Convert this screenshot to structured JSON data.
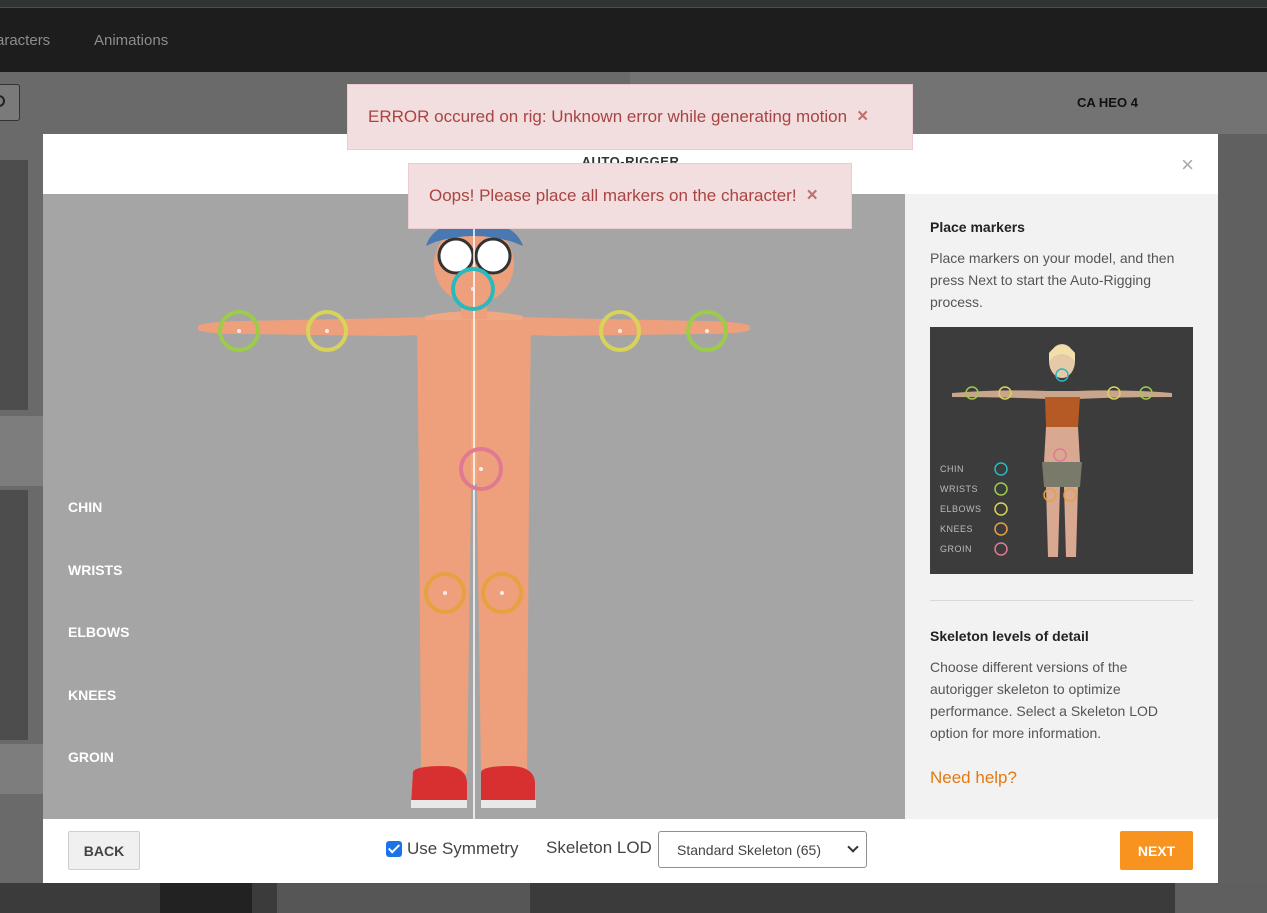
{
  "app": {
    "nav_tabs": [
      "aracters",
      "Animations"
    ],
    "character_title": "CA HEO 4"
  },
  "modal": {
    "title": "AUTO-RIGGER",
    "close_icon": "close-icon"
  },
  "toasts": [
    {
      "message": "ERROR occured on rig: Unknown error while generating motion",
      "close": "×"
    },
    {
      "message": "Oops! Please place all markers on the character!",
      "close": "×"
    }
  ],
  "legend": [
    "CHIN",
    "WRISTS",
    "ELBOWS",
    "KNEES",
    "GROIN"
  ],
  "marker_colors": {
    "chin": "#2ab9bd",
    "wrists": "#9ccc4a",
    "elbows": "#d9d35a",
    "knees": "#e8a040",
    "groin": "#e07a90"
  },
  "side": {
    "place_heading": "Place markers",
    "place_text": "Place markers on your model, and then press Next to start the Auto-Rigging process.",
    "lod_heading": "Skeleton levels of detail",
    "lod_text": "Choose different versions of the autorigger skeleton to optimize performance. Select a Skeleton LOD option for more information.",
    "help_link": "Need help?",
    "ref_legend": [
      "CHIN",
      "WRISTS",
      "ELBOWS",
      "KNEES",
      "GROIN"
    ]
  },
  "footer": {
    "back_label": "BACK",
    "symmetry_label": "Use Symmetry",
    "symmetry_checked": true,
    "lod_label": "Skeleton LOD",
    "lod_value": "Standard Skeleton (65)",
    "next_label": "NEXT"
  },
  "colors": {
    "accent": "#f7931e",
    "help_link": "#e47911",
    "toast_bg": "#f2dede",
    "toast_text": "#a94442"
  }
}
